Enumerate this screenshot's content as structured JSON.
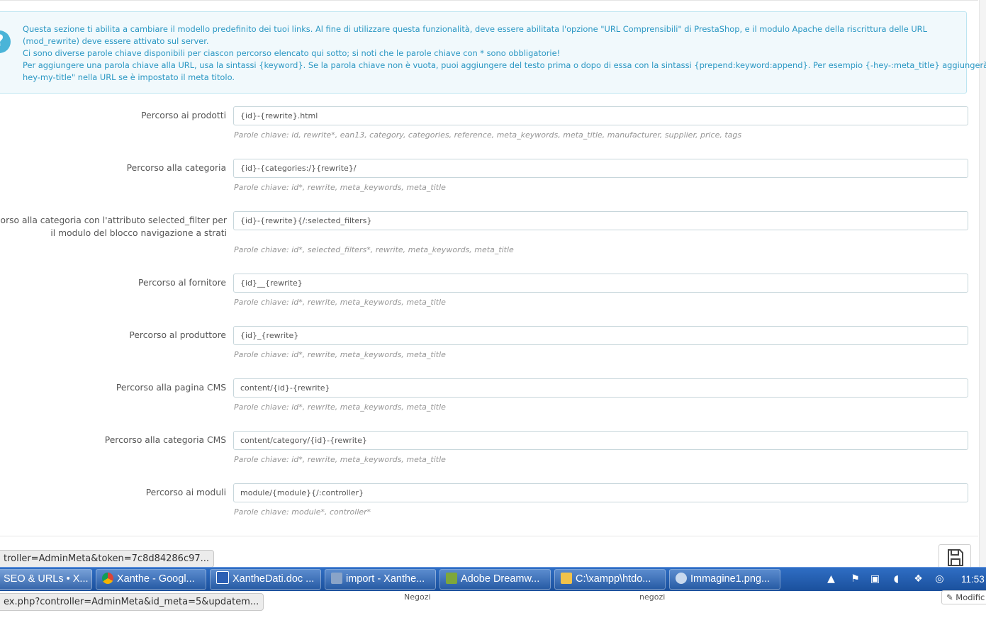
{
  "info": {
    "lines": [
      "Questa sezione ti abilita a cambiare il modello predefinito dei tuoi links. Al fine di utilizzare questa funzionalità, deve essere abilitata l'opzione \"URL Comprensibili\" di PrestaShop, e il modulo Apache della riscrittura delle URL",
      "(mod_rewrite) deve essere attivato sul server.",
      "Ci sono diverse parole chiave disponibili per ciascon percorso elencato qui sotto; si noti che le parole chiave con * sono obbligatorie!",
      "Per aggiungere una parola chiave alla URL, usa la sintassi {keyword}. Se la parola chiave non è vuota, puoi aggiungere del testo prima o dopo di essa con la sintassi {prepend:keyword:append}. Per esempio {-hey-:meta_title} aggiungerà \"-",
      "hey-my-title\" nella URL se è impostato il meta titolo."
    ]
  },
  "routes": [
    {
      "label": "Percorso ai prodotti",
      "label2": "",
      "value": "{id}-{rewrite}.html",
      "help": "Parole chiave: id, rewrite*, ean13, category, categories, reference, meta_keywords, meta_title, manufacturer, supplier, price, tags"
    },
    {
      "label": "Percorso alla categoria",
      "label2": "",
      "value": "{id}-{categories:/}{rewrite}/",
      "help": "Parole chiave: id*, rewrite, meta_keywords, meta_title"
    },
    {
      "label": "rcorso alla categoria con l'attributo selected_filter per",
      "label2": "il modulo del blocco navigazione a strati",
      "value": "{id}-{rewrite}{/:selected_filters}",
      "help": "Parole chiave: id*, selected_filters*, rewrite, meta_keywords, meta_title"
    },
    {
      "label": "Percorso al fornitore",
      "label2": "",
      "value": "{id}__{rewrite}",
      "help": "Parole chiave: id*, rewrite, meta_keywords, meta_title"
    },
    {
      "label": "Percorso al produttore",
      "label2": "",
      "value": "{id}_{rewrite}",
      "help": "Parole chiave: id*, rewrite, meta_keywords, meta_title"
    },
    {
      "label": "Percorso alla pagina CMS",
      "label2": "",
      "value": "content/{id}-{rewrite}",
      "help": "Parole chiave: id*, rewrite, meta_keywords, meta_title"
    },
    {
      "label": "Percorso alla categoria CMS",
      "label2": "",
      "value": "content/category/{id}-{rewrite}",
      "help": "Parole chiave: id*, rewrite, meta_keywords, meta_title"
    },
    {
      "label": "Percorso ai moduli",
      "label2": "",
      "value": "module/{module}{/:controller}",
      "help": "Parole chiave: module*, controller*"
    }
  ],
  "status_tip": "troller=AdminMeta&token=7c8d84286c97...",
  "url_tip": "ex.php?controller=AdminMeta&id_meta=5&updatem...",
  "taskbar": {
    "tasks": [
      {
        "label": "SEO & URLs • X...",
        "icon": "browser-icon"
      },
      {
        "label": "Xanthe - Googl...",
        "icon": "chrome-icon"
      },
      {
        "label": "XantheDati.doc ...",
        "icon": "word-icon"
      },
      {
        "label": "import - Xanthe...",
        "icon": "database-icon"
      },
      {
        "label": "Adobe Dreamw...",
        "icon": "dreamweaver-icon"
      },
      {
        "label": "C:\\xampp\\htdo...",
        "icon": "folder-icon"
      },
      {
        "label": "Immagine1.png...",
        "icon": "paint-icon"
      }
    ],
    "clock": "11:53"
  },
  "bottom_labels": [
    "Negozi",
    "negozi"
  ],
  "modify_label": "Modific",
  "colors": {
    "info_text": "#2a97c3",
    "info_bg": "#f1f9fc",
    "taskbar": "#1f5aab"
  }
}
